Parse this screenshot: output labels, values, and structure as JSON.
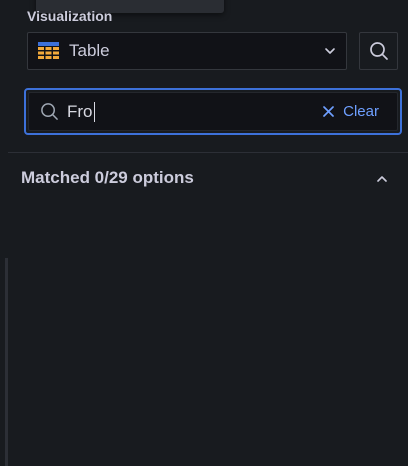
{
  "panel": {
    "section_label": "Visualization",
    "visualization": {
      "selected": "Table",
      "icon": "table-icon",
      "chevron_icon": "chevron-down-icon"
    },
    "search_button_icon": "search-icon",
    "search": {
      "value": "Fro",
      "icon": "search-icon",
      "clear_icon": "close-icon",
      "clear_label": "Clear"
    },
    "match_summary": "Matched 0/29 options",
    "collapse_icon": "chevron-up-icon"
  },
  "colors": {
    "background": "#181b1f",
    "input_background": "#111217",
    "focus_border": "#3d71d9",
    "link": "#6e9fff",
    "text": "#ccccdc"
  }
}
